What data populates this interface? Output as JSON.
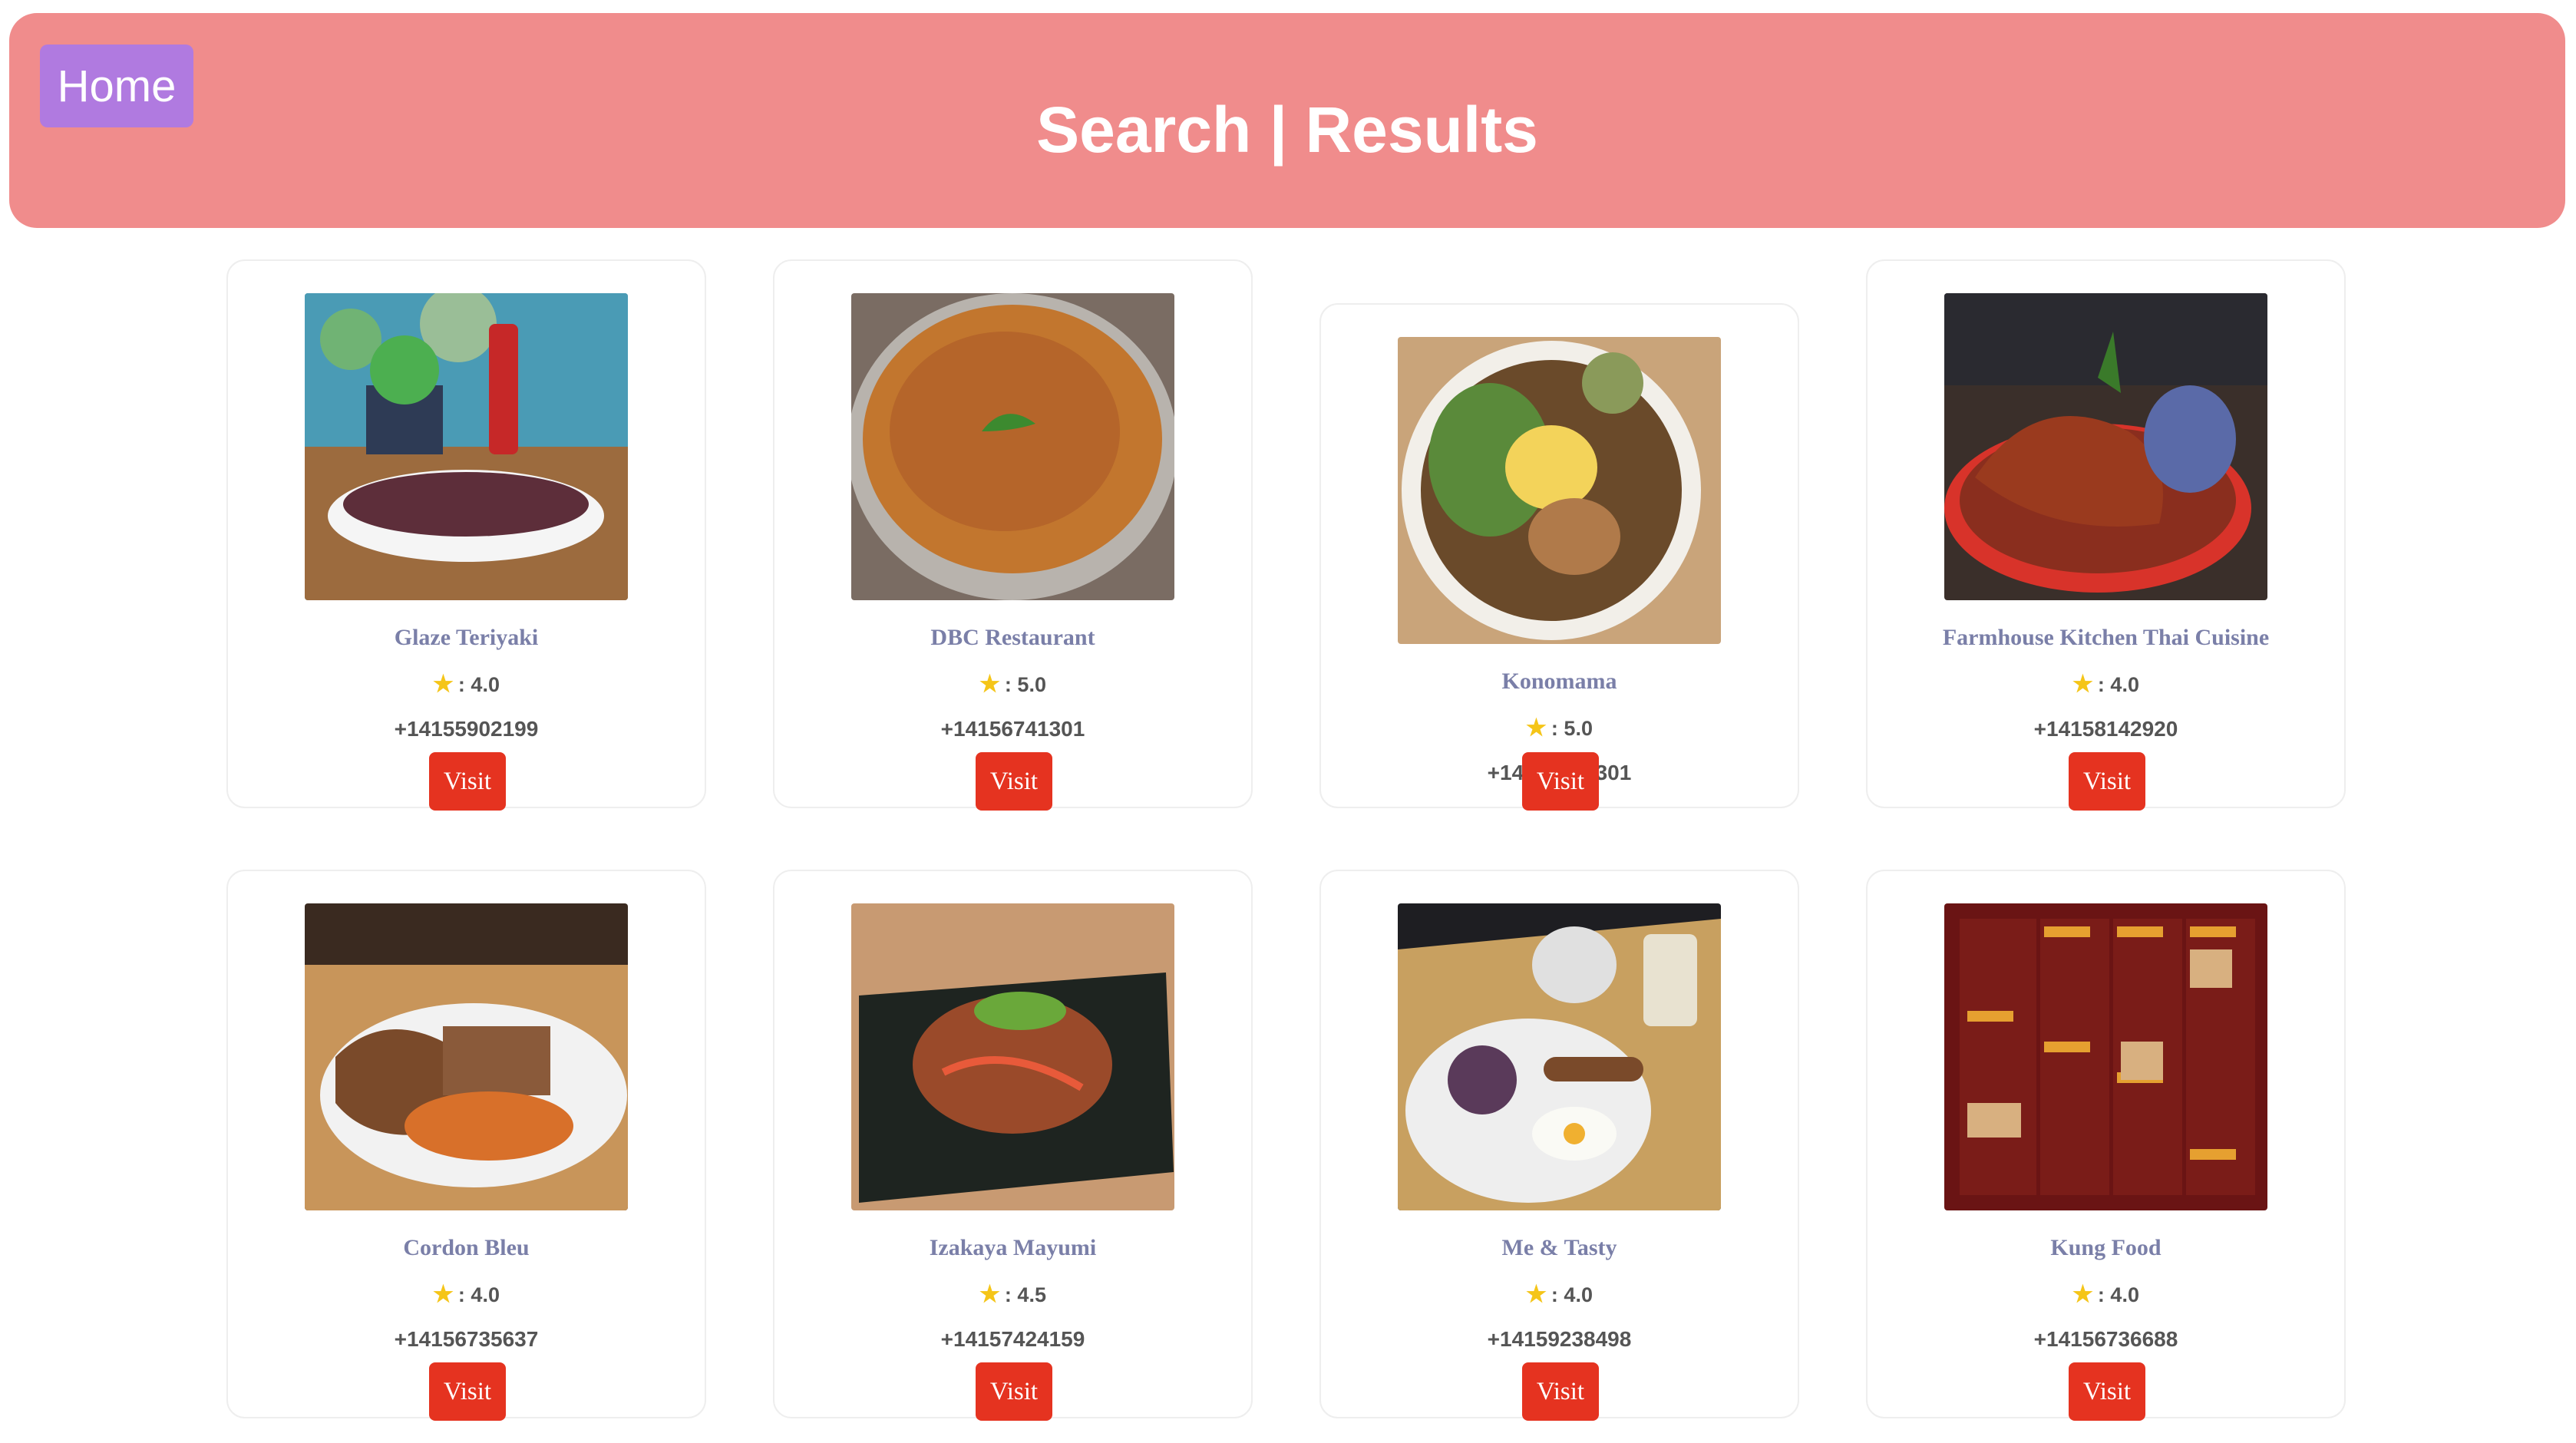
{
  "header": {
    "home_label": "Home",
    "title": "Search | Results",
    "background": "#f08c8c",
    "home_color": "#b07ae0"
  },
  "restaurants": [
    {
      "name": "Glaze Teriyaki",
      "rating": "4.0",
      "phone": "+14155902199",
      "visit_label": "Visit",
      "photo": "teriyaki-bowl-photo"
    },
    {
      "name": "DBC Restaurant",
      "rating": "5.0",
      "phone": "+14156741301",
      "visit_label": "Visit",
      "photo": "curry-dish-photo"
    },
    {
      "name": "Konomama",
      "rating": "5.0",
      "phone": "+14156741301",
      "visit_label": "Visit",
      "photo": "curry-plate-photo"
    },
    {
      "name": "Farmhouse Kitchen Thai Cuisine",
      "rating": "4.0",
      "phone": "+14158142920",
      "visit_label": "Visit",
      "photo": "braised-pork-photo"
    },
    {
      "name": "Cordon Bleu",
      "rating": "4.0",
      "phone": "+14156735637",
      "visit_label": "Visit",
      "photo": "chicken-plate-photo"
    },
    {
      "name": "Izakaya Mayumi",
      "rating": "4.5",
      "phone": "+14157424159",
      "visit_label": "Visit",
      "photo": "stir-fry-photo"
    },
    {
      "name": "Me & Tasty",
      "rating": "4.0",
      "phone": "+14159238498",
      "visit_label": "Visit",
      "photo": "breakfast-tray-photo"
    },
    {
      "name": "Kung Food",
      "rating": "4.0",
      "phone": "+14156736688",
      "visit_label": "Visit",
      "photo": "menu-photo"
    }
  ],
  "colors": {
    "visit_button": "#e53320",
    "name_text": "#7a7fa8",
    "star": "#f5c518"
  }
}
